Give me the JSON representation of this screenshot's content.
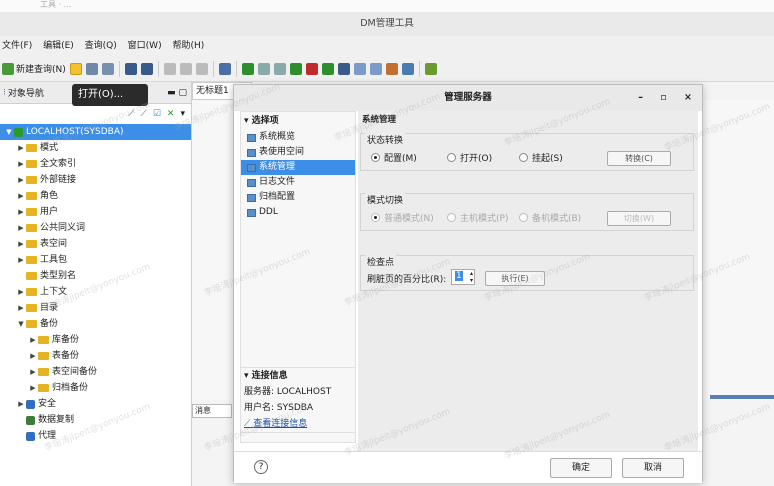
{
  "window": {
    "title": "DM管理工具",
    "top_strip": "工具 · ..."
  },
  "menubar": [
    "文件(F)",
    "编辑(E)",
    "查询(Q)",
    "窗口(W)",
    "帮助(H)"
  ],
  "toolbar": {
    "new_query": "新建查询(N)"
  },
  "tooltip": "打开(O)...",
  "left_panel": {
    "title": "对象导航",
    "tree": [
      {
        "label": "LOCALHOST(SYSDBA)",
        "level": 0,
        "selected": true,
        "arrow": "▼",
        "icon": "server-icon"
      },
      {
        "label": "模式",
        "level": 1,
        "arrow": "▶"
      },
      {
        "label": "全文索引",
        "level": 1,
        "arrow": "▶"
      },
      {
        "label": "外部链接",
        "level": 1,
        "arrow": "▶"
      },
      {
        "label": "角色",
        "level": 1,
        "arrow": "▶"
      },
      {
        "label": "用户",
        "level": 1,
        "arrow": "▶"
      },
      {
        "label": "公共同义词",
        "level": 1,
        "arrow": "▶"
      },
      {
        "label": "表空间",
        "level": 1,
        "arrow": "▶"
      },
      {
        "label": "工具包",
        "level": 1,
        "arrow": "▶"
      },
      {
        "label": "类型别名",
        "level": 1,
        "arrow": ""
      },
      {
        "label": "上下文",
        "level": 1,
        "arrow": "▶"
      },
      {
        "label": "目录",
        "level": 1,
        "arrow": "▶"
      },
      {
        "label": "备份",
        "level": 1,
        "arrow": "▼"
      },
      {
        "label": "库备份",
        "level": 2,
        "arrow": "▶"
      },
      {
        "label": "表备份",
        "level": 2,
        "arrow": "▶"
      },
      {
        "label": "表空间备份",
        "level": 2,
        "arrow": "▶"
      },
      {
        "label": "归档备份",
        "level": 2,
        "arrow": "▶"
      },
      {
        "label": "安全",
        "level": 1,
        "arrow": "▶",
        "icon": "shield-icon"
      },
      {
        "label": "数据复制",
        "level": 1,
        "arrow": "",
        "icon": "replication-icon"
      },
      {
        "label": "代理",
        "level": 1,
        "arrow": "",
        "icon": "agent-icon"
      }
    ]
  },
  "editor_tab": "无标题1",
  "message_tab": "消息",
  "dialog": {
    "title": "管理服务器",
    "select_header": "选择项",
    "options": [
      "系统概览",
      "表使用空间",
      "系统管理",
      "日志文件",
      "归档配置",
      "DDL"
    ],
    "selected_option": "系统管理",
    "connection_header": "连接信息",
    "server": "服务器: LOCALHOST",
    "user": "用户名: SYSDBA",
    "view_conn": "查看连接信息",
    "section_title": "系统管理",
    "state_group": {
      "title": "状态转换",
      "options": [
        "配置(M)",
        "打开(O)",
        "挂起(S)"
      ],
      "selected": "配置(M)",
      "button": "转换(C)"
    },
    "mode_group": {
      "title": "模式切换",
      "options": [
        "普通模式(N)",
        "主机模式(P)",
        "备机模式(B)"
      ],
      "selected": "普通模式(N)",
      "button": "切换(W)"
    },
    "checkpoint_group": {
      "title": "检查点",
      "label": "刷脏页的百分比(R):",
      "value": "1",
      "button": "执行(E)"
    },
    "ok": "确定",
    "cancel": "取消",
    "help_icon": "?"
  },
  "watermark": "李培涛jlpeit@yonyou.com"
}
